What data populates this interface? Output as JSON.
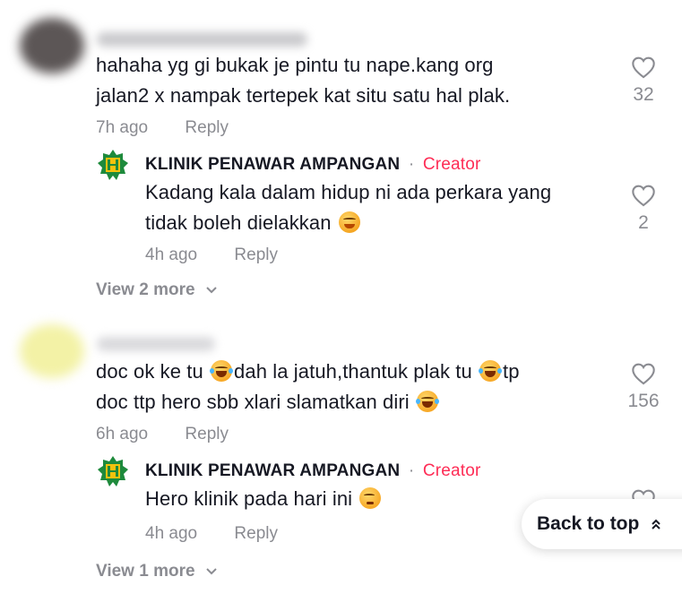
{
  "comments": [
    {
      "text_line1": "hahaha yg gi bukak je pintu tu nape.kang org",
      "text_line2": "jalan2 x nampak tertepek kat situ satu hal plak.",
      "time": "7h ago",
      "reply_label": "Reply",
      "likes": "32",
      "reply": {
        "author": "KLINIK PENAWAR AMPANGAN",
        "dot": "·",
        "badge": "Creator",
        "text_line1": "Kadang kala dalam hidup ni ada perkara yang",
        "text_line2": "tidak boleh dielakkan",
        "time": "4h ago",
        "reply_label": "Reply",
        "likes": "2"
      },
      "view_more": "View 2 more"
    },
    {
      "text_line1_a": "doc ok ke tu",
      "text_line1_b": "dah la jatuh,thantuk plak tu",
      "text_line1_c": "tp",
      "text_line2": "doc ttp hero sbb xlari slamatkan diri",
      "time": "6h ago",
      "reply_label": "Reply",
      "likes": "156",
      "reply": {
        "author": "KLINIK PENAWAR AMPANGAN",
        "dot": "·",
        "badge": "Creator",
        "text_line1": "Hero klinik pada hari ini",
        "time": "4h ago",
        "reply_label": "Reply"
      },
      "view_more": "View 1 more"
    }
  ],
  "back_to_top": "Back to top",
  "colors": {
    "text": "#161823",
    "muted": "#8a8b91",
    "creator_badge": "#fe2c55"
  }
}
